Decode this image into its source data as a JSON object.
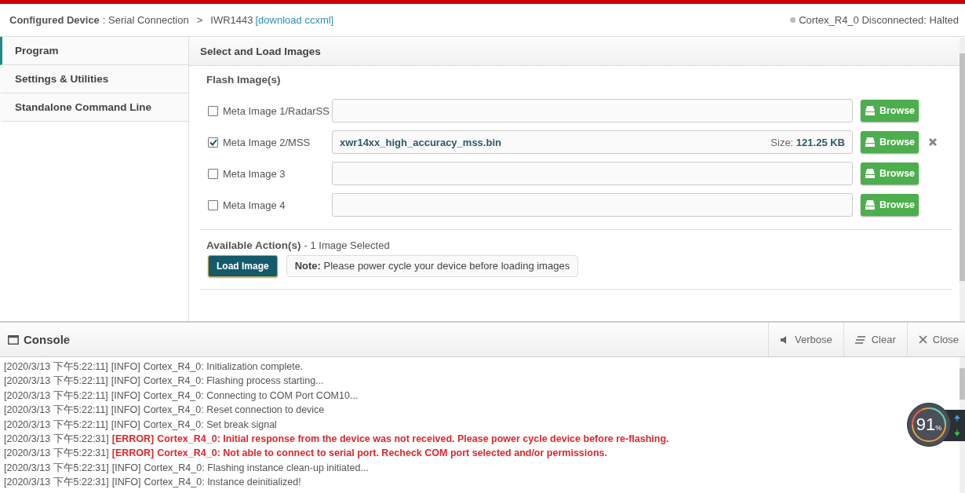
{
  "header": {
    "breadcrumb_label": "Configured Device",
    "breadcrumb_value": ": Serial Connection",
    "separator": ">",
    "device": "IWR1443",
    "download_link": "[download ccxml]",
    "status": "Cortex_R4_0 Disconnected: Halted"
  },
  "sidebar": {
    "items": [
      {
        "label": "Program",
        "selected": true
      },
      {
        "label": "Settings & Utilities",
        "selected": false
      },
      {
        "label": "Standalone Command Line",
        "selected": false
      }
    ]
  },
  "panel": {
    "title": "Select and Load Images",
    "flash_heading": "Flash Image(s)",
    "images": [
      {
        "label": "Meta Image 1/RadarSS",
        "checked": false,
        "browse": "Browse"
      },
      {
        "label": "Meta Image 2/MSS",
        "checked": true,
        "file": "xwr14xx_high_accuracy_mss.bin",
        "size_label": "Size:",
        "size": "121.25 KB",
        "browse": "Browse"
      },
      {
        "label": "Meta Image 3",
        "checked": false,
        "browse": "Browse"
      },
      {
        "label": "Meta Image 4",
        "checked": false,
        "browse": "Browse"
      }
    ],
    "actions_heading": "Available Action(s)",
    "actions_count": "- 1 Image Selected",
    "load_button": "Load Image",
    "note_label": "Note:",
    "note": "Please power cycle your device before loading images"
  },
  "console": {
    "title": "Console",
    "buttons": [
      {
        "label": "Verbose",
        "kind": "verbose"
      },
      {
        "label": "Clear",
        "kind": "clear"
      },
      {
        "label": "Close",
        "kind": "close"
      }
    ],
    "lines": [
      {
        "time": "[2020/3/13 下午5:22:11]",
        "level": "[INFO]",
        "message": "Cortex_R4_0: Initialization complete.",
        "kind": "info"
      },
      {
        "time": "[2020/3/13 下午5:22:11]",
        "level": "[INFO]",
        "message": "Cortex_R4_0: Flashing process starting...",
        "kind": "info"
      },
      {
        "time": "[2020/3/13 下午5:22:11]",
        "level": "[INFO]",
        "message": "Cortex_R4_0: Connecting to COM Port COM10...",
        "kind": "info"
      },
      {
        "time": "[2020/3/13 下午5:22:11]",
        "level": "[INFO]",
        "message": "Cortex_R4_0: Reset connection to device",
        "kind": "info"
      },
      {
        "time": "[2020/3/13 下午5:22:11]",
        "level": "[INFO]",
        "message": "Cortex_R4_0: Set break signal",
        "kind": "info"
      },
      {
        "time": "[2020/3/13 下午5:22:31]",
        "level": "[ERROR]",
        "message": "Cortex_R4_0: Initial response from the device was not received. Please power cycle device before re-flashing.",
        "kind": "error"
      },
      {
        "time": "[2020/3/13 下午5:22:31]",
        "level": "[ERROR]",
        "message": "Cortex_R4_0: Not able to connect to serial port. Recheck COM port selected and/or permissions.",
        "kind": "error"
      },
      {
        "time": "[2020/3/13 下午5:22:31]",
        "level": "[INFO]",
        "message": "Cortex_R4_0: Flashing instance clean-up initiated...",
        "kind": "info"
      },
      {
        "time": "[2020/3/13 下午5:22:31]",
        "level": "[INFO]",
        "message": "Cortex_R4_0: Instance deinitialized!",
        "kind": "info"
      }
    ]
  },
  "monitor_widget": {
    "value": "91",
    "unit": "%"
  }
}
